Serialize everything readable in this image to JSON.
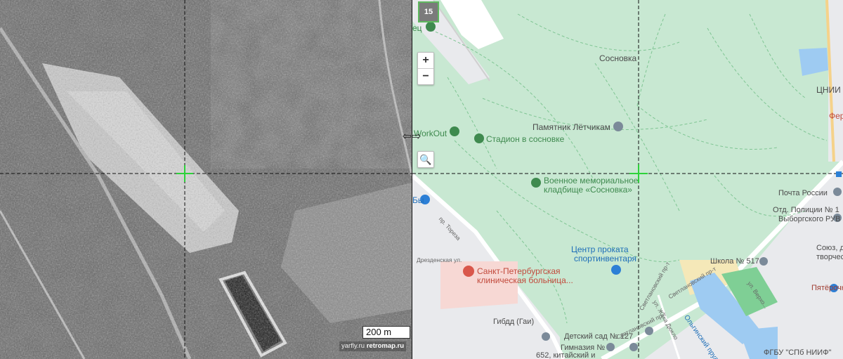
{
  "left_pane": {
    "scale_label": "200 m",
    "watermark_1": "yarfly.ru",
    "watermark_2": "retromap.ru"
  },
  "right_pane": {
    "zoom_level": "15",
    "zoom_in_label": "+",
    "zoom_out_label": "−",
    "search_icon": "magnifier-icon",
    "split_handle_label": "⇦⇨",
    "colors": {
      "park": "#c8e8d2",
      "urban": "#e9eaed",
      "road": "#ffffff",
      "water": "#9ecbf2",
      "green_poi": "#3f8a4f",
      "hospital": "#f7d8d4",
      "school_yard": "#f5e8b8",
      "crosshair": "#2dd23a"
    },
    "labels": {
      "top_fragment": "ец",
      "sosnovka": "Сосновка",
      "cnii": "ЦНИИ",
      "fer": "Фер",
      "workout": "WorkOut",
      "stadium": "Стадион в сосновке",
      "monument": "Памятник Лётчикам",
      "cemetery_1": "Военное мемориальное",
      "cemetery_2": "кладбище «Сосновка»",
      "pochta": "Почта России",
      "police_1": "Отд. Полиции № 1",
      "police_2": "Выборгского РУВ",
      "rental_1": "Центр проката",
      "rental_2": "спортинвентаря",
      "hospital_1": "Санкт-Петербургская",
      "hospital_2": "клиническая больница...",
      "school": "Школа № 517",
      "union_1": "Союз, до",
      "union_2": "творчест",
      "pyaterochka": "Пятёрочк",
      "gibdd": "Гибдд (Гаи)",
      "kindergarten": "Детский сад № 127",
      "gymnasium": "Гимназия №",
      "chinese_1": "652, китайский и",
      "lake": "Ольгинский пруд",
      "fgbu": "ФГБУ \"СПб НИИФ\"",
      "street_toreza": "пр. Тореза",
      "street_drezden": "Дрезденская ул.",
      "street_svetl_1": "Светлановский пр-т",
      "street_svetl_2": "Светлановский пр-т",
      "street_svetl_3": "Светлановский пр-т",
      "street_zhaka": "ул. Жака Дюкло",
      "street_verkh": "ул. Верхо...",
      "bus_fragment": "Бы"
    }
  }
}
